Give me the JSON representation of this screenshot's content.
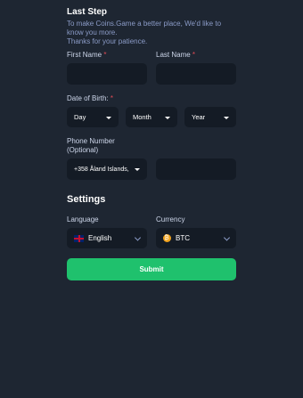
{
  "header": {
    "title": "Last Step",
    "intro_line1": "To make Coins.Game a better place, We'd like to",
    "intro_line2": "know you more.",
    "intro_line3": "Thanks for your patience."
  },
  "form": {
    "first_name_label": "First Name",
    "last_name_label": "Last Name",
    "required_mark": "*",
    "first_name_value": "",
    "last_name_value": "",
    "dob_label": "Date of Birth:",
    "dob_day": "Day",
    "dob_month": "Month",
    "dob_year": "Year",
    "phone_label_line1": "Phone Number",
    "phone_label_line2": "(Optional)",
    "phone_country": "+358 Åland Islands,",
    "phone_value": ""
  },
  "settings": {
    "title": "Settings",
    "language_label": "Language",
    "language_value": "English",
    "language_icon": "uk-flag-icon",
    "currency_label": "Currency",
    "currency_value": "BTC",
    "currency_icon": "btc-coin-icon"
  },
  "actions": {
    "submit_label": "Submit"
  },
  "colors": {
    "background": "#1e2632",
    "field": "#141b25",
    "accent_green": "#1fc16d",
    "required_red": "#e04b55",
    "muted_text": "#8b9bc7"
  }
}
